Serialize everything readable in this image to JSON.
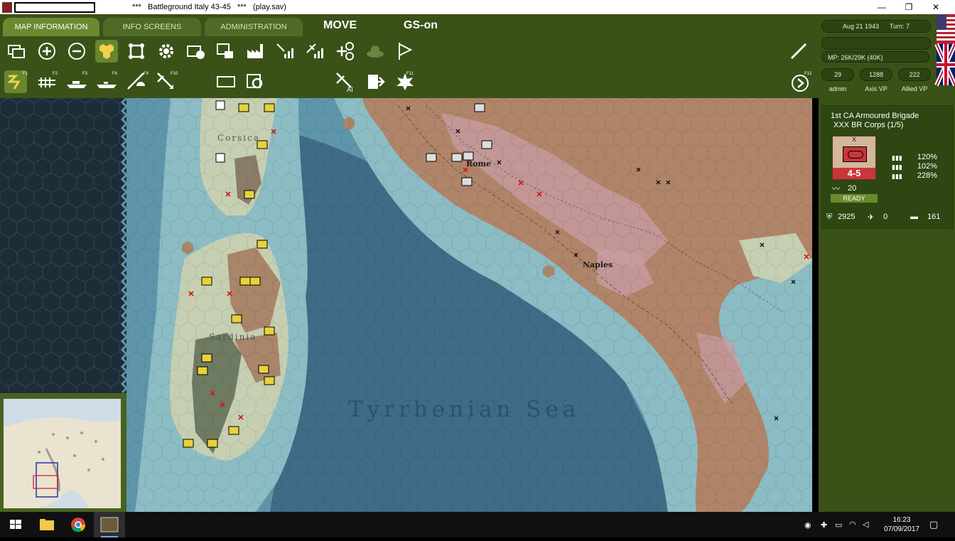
{
  "window": {
    "title": "***   Battleground Italy 43-45   ***   (play.sav)",
    "minimize": "—",
    "restore": "❐",
    "close": "✕"
  },
  "tabs": [
    {
      "label": "MAP INFORMATION",
      "active": true
    },
    {
      "label": "INFO SCREENS",
      "active": false
    },
    {
      "label": "ADMINISTRATION",
      "active": false
    }
  ],
  "mode": {
    "move": "MOVE",
    "gs": "GS-on"
  },
  "toolbar_row1": [
    "layers-icon",
    "zoom-in-icon",
    "zoom-out-icon",
    "hex-grid-icon",
    "frame-icon",
    "gear-icon",
    "unit-toggle-icon",
    "counter-stack-icon",
    "industry-icon",
    "supply-signal-icon",
    "air-signal-icon",
    "target-icon",
    "weather-icon",
    "flag-icon",
    "pencil-icon"
  ],
  "function_keys": {
    "f1": "F1",
    "f2": "F2",
    "f3": "F3",
    "f4": "F4",
    "f9": "F9",
    "f10": "F10",
    "f11": "F11",
    "f12": "F12"
  },
  "status": {
    "date": "Aug 21 1943",
    "turn": "Turn: 7",
    "mp": "MP: 26K/29K (40K)",
    "admin_value": "29",
    "admin_label": "admin",
    "axis_vp_value": "1288",
    "axis_vp_label": "Axis VP",
    "allied_vp_value": "222",
    "allied_vp_label": "Allied VP"
  },
  "unit": {
    "name": "1st CA Armoured Brigade",
    "corps": "XXX BR Corps (1/5)",
    "size_mark": "X",
    "strength": "4-5",
    "moves": "20",
    "pct1": "120%",
    "pct2": "102%",
    "pct3": "228%",
    "status": "READY",
    "men": "2925",
    "planes": "0",
    "tanks": "161"
  },
  "map_labels": {
    "corsica": "Corsica",
    "sardinia": "Sardinia",
    "rome": "Rome",
    "naples": "Naples",
    "sea": "Tyrrhenian Sea"
  },
  "colors": {
    "panel": "#3a5218",
    "tab": "#4f6a24",
    "sea_deep": "#3e6a86",
    "sea_shallow": "#6aa0b4",
    "coast": "#8fc0c6",
    "land_plain": "#c6cfb2",
    "land_hill": "#a9856a",
    "mountain": "#c89da4"
  },
  "taskbar": {
    "time": "16:23",
    "date": "07/09/2017"
  }
}
